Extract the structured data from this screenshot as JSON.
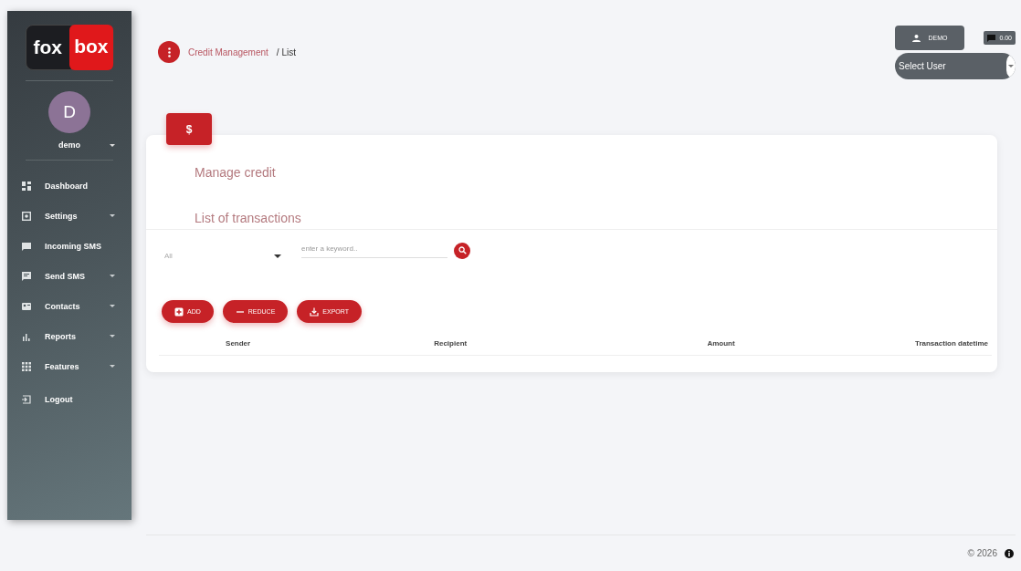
{
  "sidebar": {
    "logo": {
      "part_1": "fox",
      "part_2": "box"
    },
    "user": {
      "initial": "D",
      "name": "demo"
    },
    "items": [
      {
        "label": "Dashboard",
        "submenu": false
      },
      {
        "label": "Settings",
        "submenu": true
      },
      {
        "label": "Incoming SMS",
        "submenu": false
      },
      {
        "label": "Send SMS",
        "submenu": true
      },
      {
        "label": "Contacts",
        "submenu": true
      },
      {
        "label": "Reports",
        "submenu": true
      },
      {
        "label": "Features",
        "submenu": true
      },
      {
        "label": "Logout",
        "submenu": false
      }
    ]
  },
  "breadcrumb": {
    "parent": "Credit Management",
    "current": "/ List"
  },
  "topbar": {
    "user_button": "DEMO",
    "balance": "0.00",
    "user_select": {
      "placeholder": "Select User"
    }
  },
  "card": {
    "tab_icon": "$",
    "title": "Manage credit",
    "subtitle": "List of transactions",
    "filter": {
      "value": "All"
    },
    "search": {
      "placeholder": "enter a keyword.."
    },
    "buttons": [
      {
        "label": "ADD",
        "kind": "add"
      },
      {
        "label": "REDUCE",
        "kind": "reduce"
      },
      {
        "label": "EXPORT",
        "kind": "export"
      }
    ],
    "table": {
      "columns": [
        "Sender",
        "Recipient",
        "Amount",
        "Transaction datetime"
      ]
    }
  },
  "footer": {
    "copyright": "© 2026"
  }
}
